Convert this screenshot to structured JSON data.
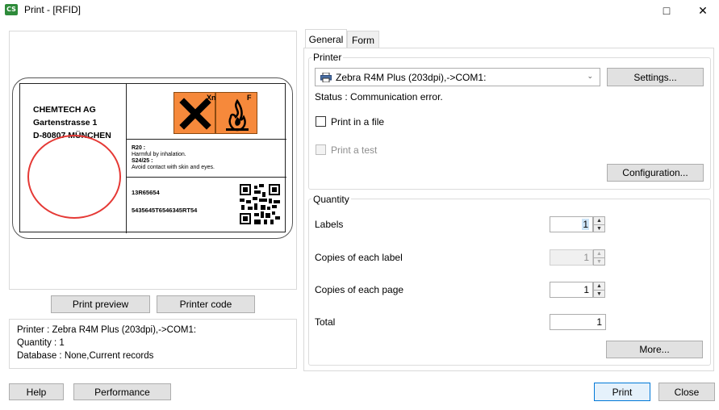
{
  "window": {
    "title": "Print - [RFID]",
    "app_icon_text": "CS",
    "maximize_glyph": "□",
    "close_glyph": "✕"
  },
  "preview": {
    "company_lines": [
      "CHEMTECH AG",
      "Gartenstrasse 1",
      "D-80807 MÜNCHEN"
    ],
    "hazard_symbols": [
      {
        "letter": "Xn",
        "icon": "harmful-x-icon"
      },
      {
        "letter": "F",
        "icon": "flammable-icon"
      }
    ],
    "risk_text": [
      "R20 :",
      "Harmful by inhalation.",
      "S24/25 :",
      "Avoid contact with skin and eyes."
    ],
    "code1": "13R65654",
    "code2": "5435645T6546345RT54",
    "preview_button": "Print preview",
    "printer_code_button": "Printer code"
  },
  "info": {
    "line1": "Printer : Zebra R4M Plus (203dpi),->COM1:",
    "line2": "Quantity : 1",
    "line3": "Database : None,Current records"
  },
  "tabs": [
    {
      "label": "General",
      "active": true
    },
    {
      "label": "Form",
      "active": false
    }
  ],
  "printer_group": {
    "title": "Printer",
    "selected_printer": "Zebra R4M Plus (203dpi),->COM1:",
    "settings_button": "Settings...",
    "status": "Status : Communication error.",
    "print_in_file": "Print in a file",
    "print_in_file_checked": false,
    "print_test": "Print a test",
    "print_test_checked": false,
    "configuration_button": "Configuration..."
  },
  "quantity_group": {
    "title": "Quantity",
    "labels_label": "Labels",
    "labels_value": "1",
    "copies_label_label": "Copies of each label",
    "copies_label_value": "1",
    "copies_page_label": "Copies of each page",
    "copies_page_value": "1",
    "total_label": "Total",
    "total_value": "1",
    "more_button": "More..."
  },
  "footer": {
    "help_button": "Help",
    "performance_button": "Performance",
    "print_button": "Print",
    "close_button": "Close"
  },
  "colors": {
    "hazard_orange": "#f6893b",
    "circle_red": "#e53935",
    "primary_border": "#0078d7"
  }
}
